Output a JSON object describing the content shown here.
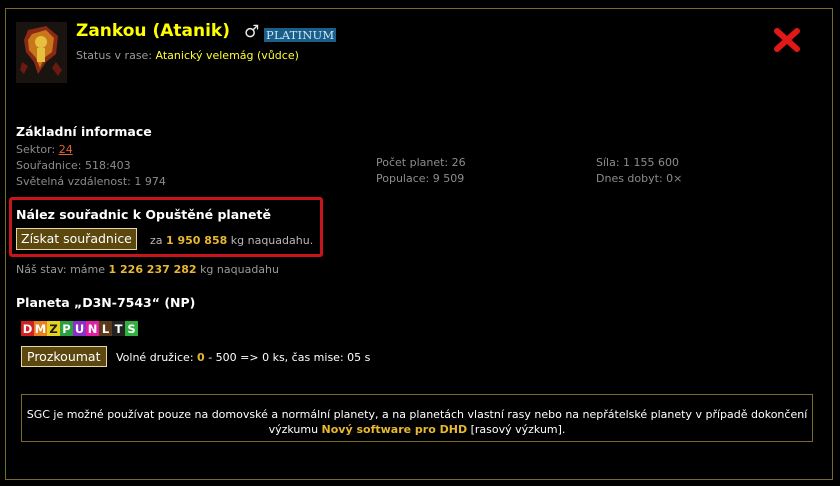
{
  "header": {
    "name": "Zankou (Atanik)",
    "gender_symbol": "♂",
    "badge": "PLATINUM",
    "status_label": "Status v rase:",
    "status_value": "Atanický velemág (vůdce)"
  },
  "basic": {
    "heading": "Základní informace",
    "sector_label": "Sektor:",
    "sector_value": "24",
    "coords_label": "Souřadnice:",
    "coords_value": "518:403",
    "distance_label": "Světelná vzdálenost:",
    "distance_value": "1 974",
    "planets_label": "Počet planet:",
    "planets_value": "26",
    "population_label": "Populace:",
    "population_value": "9 509",
    "strength_label": "Síla:",
    "strength_value": "1 155 600",
    "conquered_label": "Dnes dobyt:",
    "conquered_value": "0×"
  },
  "coords_offer": {
    "heading": "Nález souřadnic k Opuštěné planetě",
    "button": "Získat souřadnice",
    "price_prefix": "za",
    "price_value": "1 950 858",
    "price_unit": "kg naquadahu."
  },
  "state": {
    "prefix": "Náš stav: máme",
    "value": "1 226 237 282",
    "unit": "kg naquadahu"
  },
  "planet": {
    "heading": "Planeta „D3N-7543“ (NP)",
    "tags": [
      {
        "letter": "D",
        "bg": "#d42020",
        "fg": "#ffffff"
      },
      {
        "letter": "M",
        "bg": "#e88020",
        "fg": "#ffffff"
      },
      {
        "letter": "Z",
        "bg": "#e8d020",
        "fg": "#1a1a1a"
      },
      {
        "letter": "P",
        "bg": "#2aa040",
        "fg": "#ffffff"
      },
      {
        "letter": "U",
        "bg": "#8a2fc8",
        "fg": "#ffffff"
      },
      {
        "letter": "N",
        "bg": "#e020a0",
        "fg": "#ffffff"
      },
      {
        "letter": "L",
        "bg": "#5a3a1a",
        "fg": "#ffffff"
      },
      {
        "letter": "T",
        "bg": "#222222",
        "fg": "#ffffff"
      },
      {
        "letter": "S",
        "bg": "#30b040",
        "fg": "#ffffff"
      }
    ],
    "explore_button": "Prozkoumat",
    "free_label": "Volné družice:",
    "free_value": "0",
    "free_rest": "- 500 => 0 ks, čas mise: 05 s"
  },
  "sgc_note": {
    "text_before": "SGC je možné používat pouze na domovské a normální planety, a na planetách vlastní rasy nebo na nepřátelské planety v případě dokončení výzkumu",
    "link": "Nový software pro DHD",
    "text_after": "[rasový výzkum]."
  },
  "colors": {
    "accent_yellow": "#ffff00",
    "gold": "#e8b830",
    "highlight_red": "#c8141b",
    "border": "#7a6a2e"
  },
  "icons": {
    "close": "close-icon",
    "avatar": "race-emblem-icon"
  }
}
